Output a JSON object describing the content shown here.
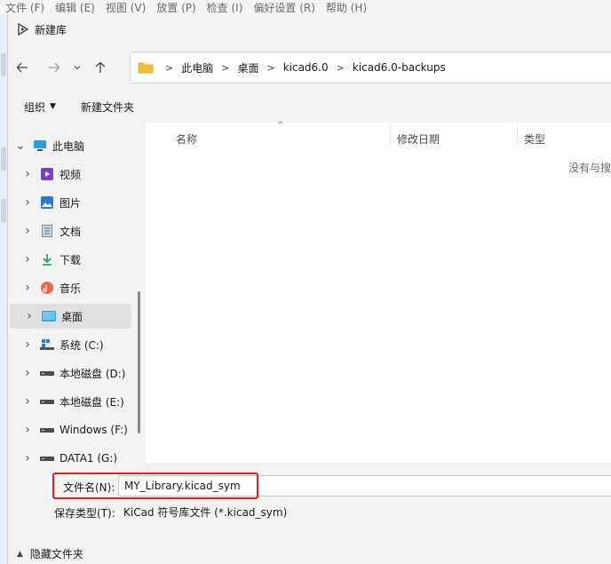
{
  "bg_menu": [
    "文件 (F)",
    "编辑 (E)",
    "视图 (V)",
    "放置 (P)",
    "检查 (I)",
    "偏好设置 (R)",
    "帮助 (H)"
  ],
  "dialog": {
    "title": "新建库"
  },
  "breadcrumb": [
    "此电脑",
    "桌面",
    "kicad6.0",
    "kicad6.0-backups"
  ],
  "toolbar": {
    "organize": "组织",
    "new_folder": "新建文件夹"
  },
  "tree": [
    {
      "label": "此电脑",
      "icon": "pc-icon",
      "level": 0
    },
    {
      "label": "视频",
      "icon": "video-icon",
      "level": 1
    },
    {
      "label": "图片",
      "icon": "pictures-icon",
      "level": 1
    },
    {
      "label": "文档",
      "icon": "documents-icon",
      "level": 1
    },
    {
      "label": "下载",
      "icon": "download-icon",
      "level": 1
    },
    {
      "label": "音乐",
      "icon": "music-icon",
      "level": 1
    },
    {
      "label": "桌面",
      "icon": "desktop-icon",
      "level": 1,
      "selected": true
    },
    {
      "label": "系统 (C:)",
      "icon": "system-drive-icon",
      "level": 1
    },
    {
      "label": "本地磁盘 (D:)",
      "icon": "drive-icon",
      "level": 1
    },
    {
      "label": "本地磁盘 (E:)",
      "icon": "drive-icon",
      "level": 1
    },
    {
      "label": "Windows (F:)",
      "icon": "drive-icon",
      "level": 1
    },
    {
      "label": "DATA1 (G:)",
      "icon": "drive-icon",
      "level": 1
    }
  ],
  "columns": {
    "name": "名称",
    "modified": "修改日期",
    "type": "类型"
  },
  "empty_message": "没有与搜",
  "filename": {
    "label": "文件名(N):",
    "value": "MY_Library.kicad_sym"
  },
  "filetype": {
    "label": "保存类型(T):",
    "value": "KiCad 符号库文件 (*.kicad_sym)"
  },
  "hide_folders": "隐藏文件夹",
  "colors": {
    "highlight": "#e02020",
    "selection": "#e0e0e0",
    "folder": "#f2c037"
  }
}
